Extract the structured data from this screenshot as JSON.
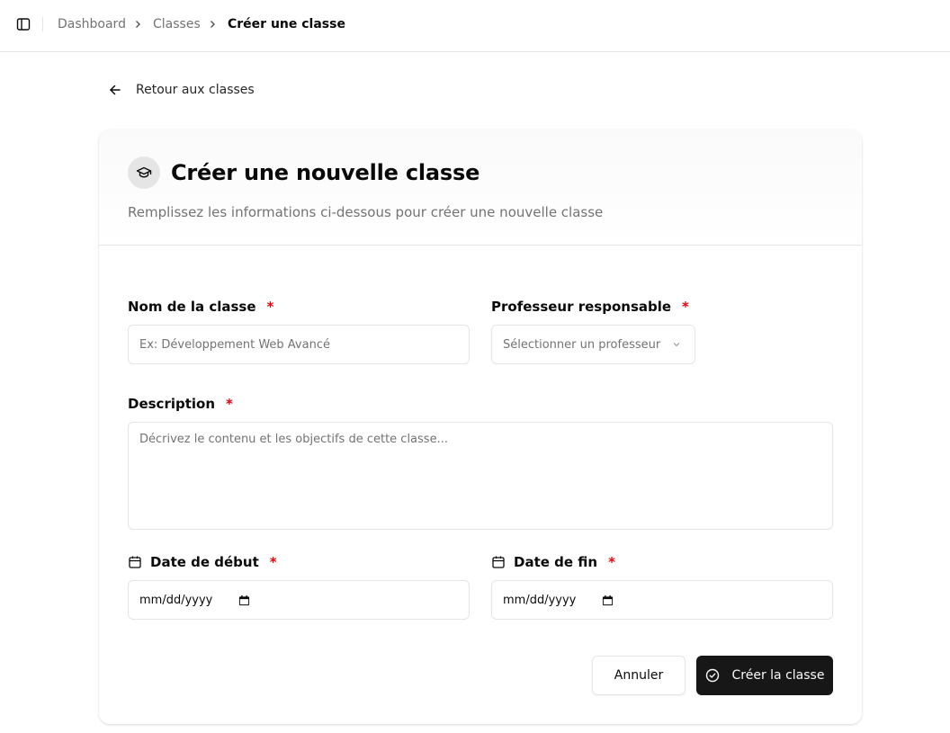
{
  "breadcrumb": {
    "items": [
      "Dashboard",
      "Classes"
    ],
    "current": "Créer une classe"
  },
  "back_link": {
    "label": "Retour aux classes"
  },
  "card": {
    "title": "Créer une nouvelle classe",
    "description": "Remplissez les informations ci-dessous pour créer une nouvelle classe"
  },
  "form": {
    "name": {
      "label": "Nom de la classe",
      "required_mark": "*",
      "placeholder": "Ex: Développement Web Avancé",
      "value": ""
    },
    "teacher": {
      "label": "Professeur responsable",
      "required_mark": "*",
      "placeholder": "Sélectionner un professeur"
    },
    "description": {
      "label": "Description",
      "required_mark": "*",
      "placeholder": "Décrivez le contenu et les objectifs de cette classe...",
      "value": ""
    },
    "start_date": {
      "label": "Date de début",
      "required_mark": "*",
      "format_hint": "mm/dd/yyyy"
    },
    "end_date": {
      "label": "Date de fin",
      "required_mark": "*",
      "format_hint": "mm/dd/yyyy"
    }
  },
  "actions": {
    "cancel_label": "Annuler",
    "submit_label": "Créer la classe"
  },
  "colors": {
    "primary": "#171717",
    "required": "#e7000b",
    "muted_text": "#737373",
    "border": "#e5e5e5"
  }
}
